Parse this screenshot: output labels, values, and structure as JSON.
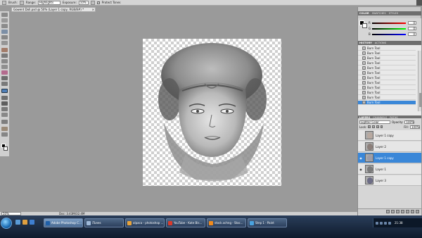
{
  "options_bar": {
    "brush_label": "Brush:",
    "range_label": "Range:",
    "range_value": "Highlights",
    "exposure_label": "Exposure:",
    "exposure_value": "10%",
    "protect_label": "Protect Tones",
    "protect_checked": "✓"
  },
  "document": {
    "tab_title": "Gowent Doll.psd @ 50% (Layer 1 copy, RGB/8#) *",
    "close_glyph": "×"
  },
  "status": {
    "zoom": "50%",
    "doc_info": "Doc: 3.43M/32.4M"
  },
  "panels": {
    "color_tabs": [
      "COLOR",
      "SWATCHES",
      "STYLES"
    ],
    "color": {
      "channels": [
        {
          "name": "R",
          "value": "0"
        },
        {
          "name": "G",
          "value": "0"
        },
        {
          "name": "B",
          "value": "0"
        }
      ]
    },
    "history_tabs": [
      "HISTORY",
      "ACTIONS"
    ],
    "history_items": [
      "Burn Tool",
      "Burn Tool",
      "Burn Tool",
      "Burn Tool",
      "Burn Tool",
      "Burn Tool",
      "Burn Tool",
      "Burn Tool",
      "Burn Tool",
      "Burn Tool",
      "Burn Tool",
      "Burn Tool"
    ],
    "history_selected_index": 11,
    "layers_tabs": [
      "LAYERS",
      "CHANNELS",
      "PATHS"
    ],
    "layers": {
      "blend_mode": "Lighter Color",
      "opacity_label": "Opacity:",
      "opacity_value": "100%",
      "lock_label": "Lock:",
      "fill_label": "Fill:",
      "fill_value": "100%",
      "items": [
        {
          "name": "Layer 1 copy",
          "visible": false,
          "selected": false
        },
        {
          "name": "Layer 2",
          "visible": false,
          "selected": false
        },
        {
          "name": "Layer 1 copy",
          "visible": true,
          "selected": true
        },
        {
          "name": "Layer 1",
          "visible": true,
          "selected": false
        },
        {
          "name": "Layer 3",
          "visible": false,
          "selected": false
        }
      ]
    }
  },
  "taskbar": {
    "tasks": [
      {
        "label": "Adobe Photoshop C...",
        "icon_color": "#1f5fa8",
        "active": true
      },
      {
        "label": "iTunes",
        "icon_color": "#9fb9d8",
        "active": false
      },
      {
        "label": "alpaca - photoshop ...",
        "icon_color": "#e8a33a",
        "active": false
      },
      {
        "label": "YouTube - Kate Bis...",
        "icon_color": "#d93a2b",
        "active": false
      },
      {
        "label": "stock.xchng - Stoc...",
        "icon_color": "#f08a1c",
        "active": false
      },
      {
        "label": "Step 1 - Paint",
        "icon_color": "#4aa3df",
        "active": false
      }
    ],
    "clock": "21:38"
  }
}
